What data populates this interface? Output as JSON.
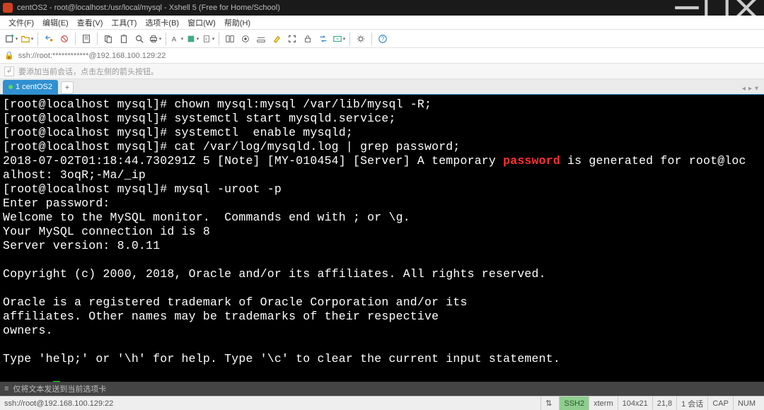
{
  "titlebar": {
    "title": "centOS2 - root@localhost:/usr/local/mysql - Xshell 5 (Free for Home/School)"
  },
  "menubar": {
    "items": [
      "文件(F)",
      "编辑(E)",
      "查看(V)",
      "工具(T)",
      "选项卡(B)",
      "窗口(W)",
      "帮助(H)"
    ]
  },
  "addressbar": {
    "text": "ssh://root:************@192.168.100.129:22"
  },
  "hintbar": {
    "text": "要添加当前会话，点击左侧的箭头按钮。"
  },
  "tabs": {
    "items": [
      {
        "label": "1 centOS2",
        "active": true
      }
    ]
  },
  "terminal": {
    "lines": [
      {
        "segments": [
          {
            "t": "[root@localhost mysql]# chown mysql:mysql /var/lib/mysql -R;"
          }
        ]
      },
      {
        "segments": [
          {
            "t": "[root@localhost mysql]# systemctl start mysqld.service;"
          }
        ]
      },
      {
        "segments": [
          {
            "t": "[root@localhost mysql]# systemctl  enable mysqld;"
          }
        ]
      },
      {
        "segments": [
          {
            "t": "[root@localhost mysql]# cat /var/log/mysqld.log | grep password;"
          }
        ]
      },
      {
        "segments": [
          {
            "t": "2018-07-02T01:18:44.730291Z 5 [Note] [MY-010454] [Server] A temporary "
          },
          {
            "t": "password",
            "cls": "highlight"
          },
          {
            "t": " is generated for root@loc"
          }
        ]
      },
      {
        "segments": [
          {
            "t": "alhost: 3oqR;-Ma/_ip"
          }
        ]
      },
      {
        "segments": [
          {
            "t": "[root@localhost mysql]# mysql -uroot -p"
          }
        ]
      },
      {
        "segments": [
          {
            "t": "Enter password:"
          }
        ]
      },
      {
        "segments": [
          {
            "t": "Welcome to the MySQL monitor.  Commands end with ; or \\g."
          }
        ]
      },
      {
        "segments": [
          {
            "t": "Your MySQL connection id is 8"
          }
        ]
      },
      {
        "segments": [
          {
            "t": "Server version: 8.0.11"
          }
        ]
      },
      {
        "segments": [
          {
            "t": ""
          }
        ]
      },
      {
        "segments": [
          {
            "t": "Copyright (c) 2000, 2018, Oracle and/or its affiliates. All rights reserved."
          }
        ]
      },
      {
        "segments": [
          {
            "t": ""
          }
        ]
      },
      {
        "segments": [
          {
            "t": "Oracle is a registered trademark of Oracle Corporation and/or its"
          }
        ]
      },
      {
        "segments": [
          {
            "t": "affiliates. Other names may be trademarks of their respective"
          }
        ]
      },
      {
        "segments": [
          {
            "t": "owners."
          }
        ]
      },
      {
        "segments": [
          {
            "t": ""
          }
        ]
      },
      {
        "segments": [
          {
            "t": "Type 'help;' or '\\h' for help. Type '\\c' to clear the current input statement."
          }
        ]
      },
      {
        "segments": [
          {
            "t": ""
          }
        ]
      },
      {
        "segments": [
          {
            "t": "mysql> "
          },
          {
            "cursor": true
          }
        ]
      }
    ]
  },
  "composebar": {
    "text": "仅将文本发送到当前选项卡"
  },
  "statusbar": {
    "left": "ssh://root@192.168.100.129:22",
    "segments": [
      "SSH2",
      "xterm",
      "104x21",
      "21,8",
      "1 会话",
      "CAP",
      "NUM"
    ],
    "green_index": 0,
    "indicator": "⇅"
  }
}
